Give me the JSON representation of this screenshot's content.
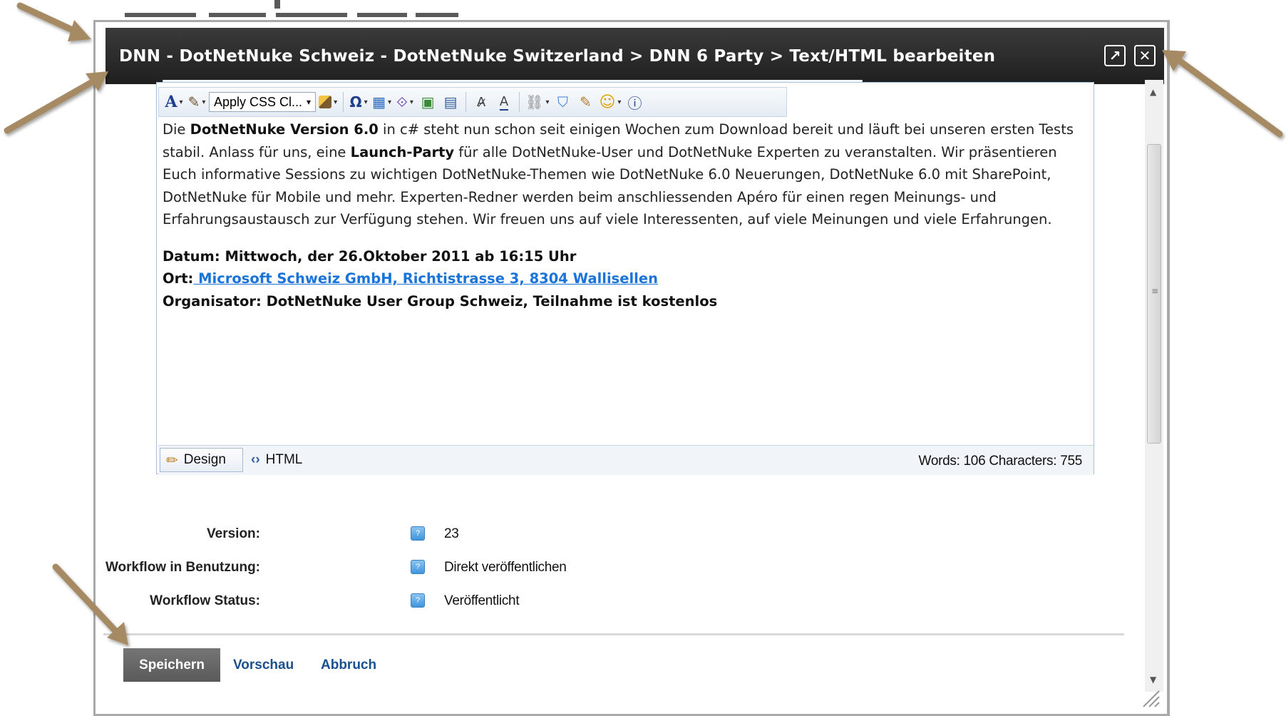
{
  "dialog": {
    "title": "DNN - DotNetNuke Schweiz - DotNetNuke Switzerland > DNN 6 Party > Text/HTML bearbeiten",
    "maximize_icon": "↗",
    "close_icon": "✕"
  },
  "toolbar": {
    "font_color_glyph": "A",
    "highlight_glyph": "✎",
    "css_class_value": "Apply CSS Cl...",
    "css_class_caret": "▾",
    "format_painter_glyph": "🖌",
    "symbol_glyph": "Ω",
    "table_glyph": "▦",
    "template_glyph": "⟐",
    "image_manager_glyph": "▣",
    "image_map_glyph": "▤",
    "spell_glyph": "A̷",
    "ajax_spell_glyph": "A",
    "link_glyph": "⛓",
    "doc_glyph": "⛉",
    "snippet_glyph": "✎",
    "smiley_glyph": "☺",
    "about_glyph": "ⓘ",
    "dropdown_arrow": "▾"
  },
  "content": {
    "p1_a": "Die ",
    "p1_b": "DotNetNuke Version 6.0",
    "p1_c": " in c# steht nun schon seit einigen Wochen zum Download bereit und läuft bei unseren ersten Tests stabil. Anlass für uns, eine ",
    "p1_d": "Launch-Party",
    "p1_e": " für alle DotNetNuke-User und DotNetNuke Experten zu veranstalten. Wir präsentieren Euch informative Sessions zu wichtigen DotNetNuke-Themen wie DotNetNuke 6.0 Neuerungen, DotNetNuke 6.0 mit SharePoint, DotNetNuke für Mobile und mehr. Experten-Redner werden beim anschliessenden Apéro für einen regen Meinungs- und Erfahrungsaustausch zur Verfügung stehen. Wir freuen uns auf viele Interessenten, auf viele Meinungen und viele Erfahrungen.",
    "datum": "Datum: Mittwoch, der 26.Oktober 2011 ab 16:15 Uhr",
    "ort_label": "Ort:",
    "ort_link": " Microsoft Schweiz GmbH, Richtistrasse 3, 8304 Wallisellen",
    "organisator": "Organisator: DotNetNuke User Group Schweiz, Teilnahme ist kostenlos"
  },
  "editor_footer": {
    "design_label": "Design",
    "html_label": "HTML",
    "counts": "Words: 106   Characters: 755"
  },
  "info": {
    "version_label": "Version:",
    "version_value": "23",
    "workflow_label": "Workflow in Benutzung:",
    "workflow_value": "Direkt veröffentlichen",
    "status_label": "Workflow Status:",
    "status_value": "Veröffentlicht",
    "help_glyph": "?"
  },
  "actions": {
    "save": "Speichern",
    "preview": "Vorschau",
    "cancel": "Abbruch"
  },
  "colors": {
    "annotation_arrow": "#a68a64",
    "titlebar": "#262626",
    "link": "#1a73d8"
  }
}
